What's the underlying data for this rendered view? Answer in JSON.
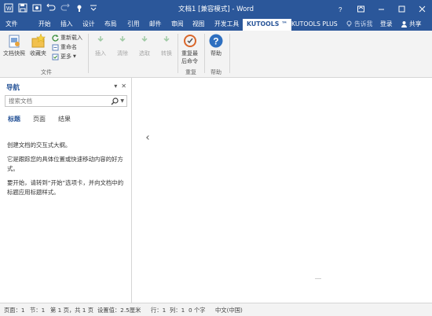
{
  "title_bar": {
    "title": "文档1 [兼容模式] - Word"
  },
  "tabs": {
    "file": "文件",
    "items": [
      "开始",
      "插入",
      "设计",
      "布局",
      "引用",
      "邮件",
      "审阅",
      "视图",
      "开发工具",
      "KUTOOLS ™",
      "KUTOOLS PLUS"
    ],
    "active": "KUTOOLS ™",
    "tell_me": "告诉我",
    "login": "登录",
    "share": "共享"
  },
  "ribbon": {
    "groups": {
      "file_label": "文件",
      "repeat_label": "重复",
      "help_label": "帮助"
    },
    "buttons": {
      "doc_snapshot": "文档快照",
      "favorites": "收藏夹",
      "reload": "重新载入",
      "rename": "重命名",
      "more": "更多",
      "insert": "插入",
      "clear": "清除",
      "select": "选取",
      "convert": "转换",
      "repeat_last": "重复最",
      "repeat_last2": "后命令",
      "help": "帮助"
    }
  },
  "nav_pane": {
    "title": "导航",
    "search_placeholder": "搜索文档",
    "tabs": [
      "标题",
      "页面",
      "结果"
    ],
    "active_tab": "标题",
    "text1": "创建文档的交互式大纲。",
    "text2": "它是跟踪您的具体位置或快速移动内容的好方式。",
    "text3": "要开始，请转到“开始”选项卡，并向文档中的标题应用标题样式。"
  },
  "status_bar": {
    "page": "页面：1",
    "section": "节：1",
    "page_of": "第 1 页，共 1 页",
    "setting": "设置值：2.5厘米",
    "line": "行：1",
    "column": "列：1",
    "words": "0 个字",
    "language": "中文(中国)"
  },
  "colors": {
    "accent": "#2b579a",
    "ribbon_bg": "#f3f3f3"
  }
}
